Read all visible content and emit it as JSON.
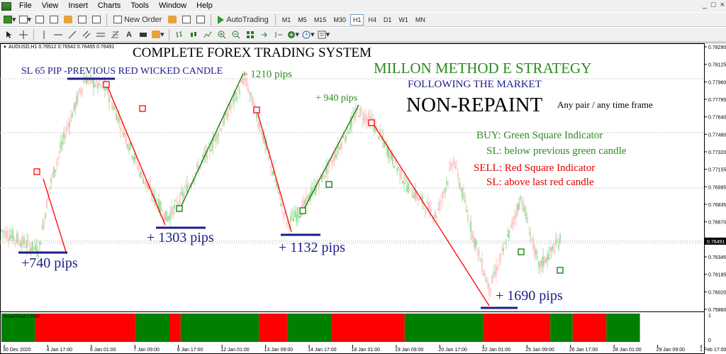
{
  "menu": {
    "items": [
      "File",
      "View",
      "Insert",
      "Charts",
      "Tools",
      "Window",
      "Help"
    ],
    "window_controls": [
      "_",
      "□",
      "×"
    ]
  },
  "toolbar": {
    "new_order_label": "New Order",
    "autotrading_label": "AutoTrading",
    "timeframes": [
      "M1",
      "M5",
      "M15",
      "M30",
      "H1",
      "H4",
      "D1",
      "W1",
      "MN"
    ],
    "active_timeframe": "H1"
  },
  "chart": {
    "symbol_info": "AUDUSD,H1  0.76512 0.76542 0.76455 0.76491",
    "current_price": "0.76491",
    "price_ticks": [
      "0.78290",
      "0.78125",
      "0.77960",
      "0.77795",
      "0.77640",
      "0.77480",
      "0.77320",
      "0.77155",
      "0.76995",
      "0.76835",
      "0.76670",
      "0.76510",
      "0.76345",
      "0.76185",
      "0.76020",
      "0.75860"
    ],
    "time_labels": [
      "30 Dec 2020",
      "4 Jan 17:00",
      "6 Jan 01:00",
      "7 Jan 09:00",
      "8 Jan 17:00",
      "12 Jan 01:00",
      "13 Jan 09:00",
      "14 Jan 17:00",
      "18 Jan 01:00",
      "19 Jan 09:00",
      "20 Jan 17:00",
      "22 Jan 01:00",
      "25 Jan 09:00",
      "26 Jan 17:00",
      "28 Jan 01:00",
      "29 Jan 09:00",
      "1 Feb 17:00"
    ],
    "colors": {
      "buy": "#008000",
      "sell": "#ff0000",
      "label_blue": "#1c1c8a",
      "candle_up": "#7fd07f",
      "candle_down": "#ffb4b4"
    }
  },
  "annotations": {
    "title": "COMPLETE FOREX TRADING SYSTEM",
    "sl_note": "SL 65 PIP -PREVIOUS RED WICKED CANDLE",
    "strategy": "MILLON METHOD E STRATEGY",
    "following": "FOLLOWING THE MARKET",
    "non_repaint": "NON-REPAINT",
    "any_pair": "Any pair / any time frame",
    "buy_rule": "BUY:  Green Square Indicator",
    "buy_sl": "SL: below previous green candle",
    "sell_rule": "SELL: Red Square Indicator",
    "sell_sl": "SL:  above last red candle",
    "pips": [
      "+ 1210 pips",
      "+ 940 pips",
      "+ 1303 pips",
      "+ 1132 pips",
      "+740 pips",
      "+ 1690 pips"
    ]
  },
  "indicator": {
    "label": "SuperTrend 1.0000",
    "scale_ticks": [
      "1",
      "0"
    ],
    "segments": [
      "buy",
      "sell",
      "buy",
      "sell",
      "buy",
      "sell",
      "buy",
      "sell",
      "buy",
      "sell",
      "buy",
      "sell",
      "buy"
    ],
    "segment_shares": [
      0.06,
      0.18,
      0.06,
      0.02,
      0.14,
      0.05,
      0.08,
      0.13,
      0.14,
      0.12,
      0.04,
      0.06,
      0.06,
      0.07,
      0.0
    ]
  }
}
